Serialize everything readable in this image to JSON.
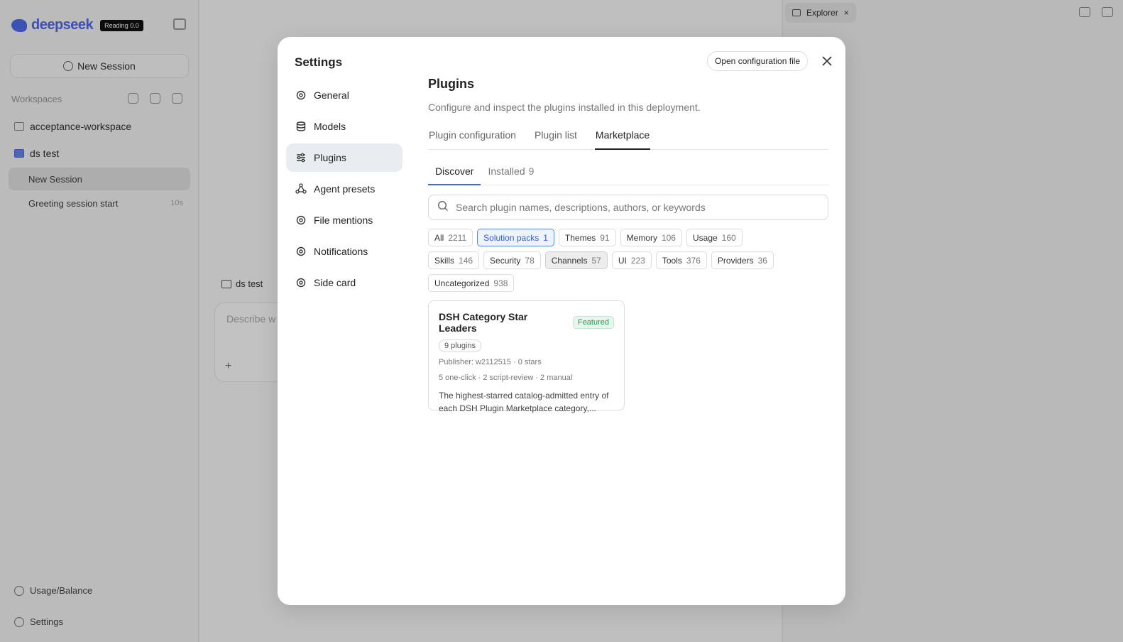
{
  "bg": {
    "logo_text": "deepseek",
    "logo_badge": "Reading 0.0",
    "new_session": "New Session",
    "workspaces_label": "Workspaces",
    "workspaces": [
      {
        "name": "acceptance-workspace"
      },
      {
        "name": "ds test"
      }
    ],
    "sessions": [
      {
        "title": "New Session",
        "age": ""
      },
      {
        "title": "Greeting session start",
        "age": "10s"
      }
    ],
    "usage_label": "Usage/Balance",
    "settings_label": "Settings",
    "composer_tag": "ds test",
    "composer_placeholder": "Describe w",
    "explorer_tab": "Explorer"
  },
  "modal": {
    "title": "Settings",
    "open_config": "Open configuration file",
    "nav": [
      {
        "label": "General",
        "icon": "gear-icon"
      },
      {
        "label": "Models",
        "icon": "database-icon"
      },
      {
        "label": "Plugins",
        "icon": "sliders-icon"
      },
      {
        "label": "Agent presets",
        "icon": "network-icon"
      },
      {
        "label": "File mentions",
        "icon": "gear-icon"
      },
      {
        "label": "Notifications",
        "icon": "gear-icon"
      },
      {
        "label": "Side card",
        "icon": "gear-icon"
      }
    ],
    "active_nav": "Plugins"
  },
  "plugins": {
    "title": "Plugins",
    "description": "Configure and inspect the plugins installed in this deployment.",
    "tabs": [
      "Plugin configuration",
      "Plugin list",
      "Marketplace"
    ],
    "active_tab": "Marketplace",
    "subtabs": [
      {
        "label": "Discover",
        "count": ""
      },
      {
        "label": "Installed",
        "count": "9"
      }
    ],
    "search_placeholder": "Search plugin names, descriptions, authors, or keywords",
    "categories": [
      {
        "label": "All",
        "count": "2211",
        "state": ""
      },
      {
        "label": "Solution packs",
        "count": "1",
        "state": "selected"
      },
      {
        "label": "Themes",
        "count": "91",
        "state": ""
      },
      {
        "label": "Memory",
        "count": "106",
        "state": ""
      },
      {
        "label": "Usage",
        "count": "160",
        "state": ""
      },
      {
        "label": "Skills",
        "count": "146",
        "state": ""
      },
      {
        "label": "Security",
        "count": "78",
        "state": ""
      },
      {
        "label": "Channels",
        "count": "57",
        "state": "hover"
      },
      {
        "label": "UI",
        "count": "223",
        "state": ""
      },
      {
        "label": "Tools",
        "count": "376",
        "state": ""
      },
      {
        "label": "Providers",
        "count": "36",
        "state": ""
      },
      {
        "label": "Uncategorized",
        "count": "938",
        "state": ""
      }
    ],
    "card": {
      "title": "DSH Category Star Leaders",
      "badge": "Featured",
      "plugins_count": "9 plugins",
      "publisher": "Publisher: w2112515 · 0 stars",
      "install_modes": "5 one-click · 2 script-review · 2 manual",
      "description": "The highest-starred catalog-admitted entry of each DSH Plugin Marketplace category,..."
    }
  },
  "colors": {
    "accent": "#3b6be0",
    "featured": "#1e9a4f",
    "nav_active_bg": "#e9ecf1"
  }
}
